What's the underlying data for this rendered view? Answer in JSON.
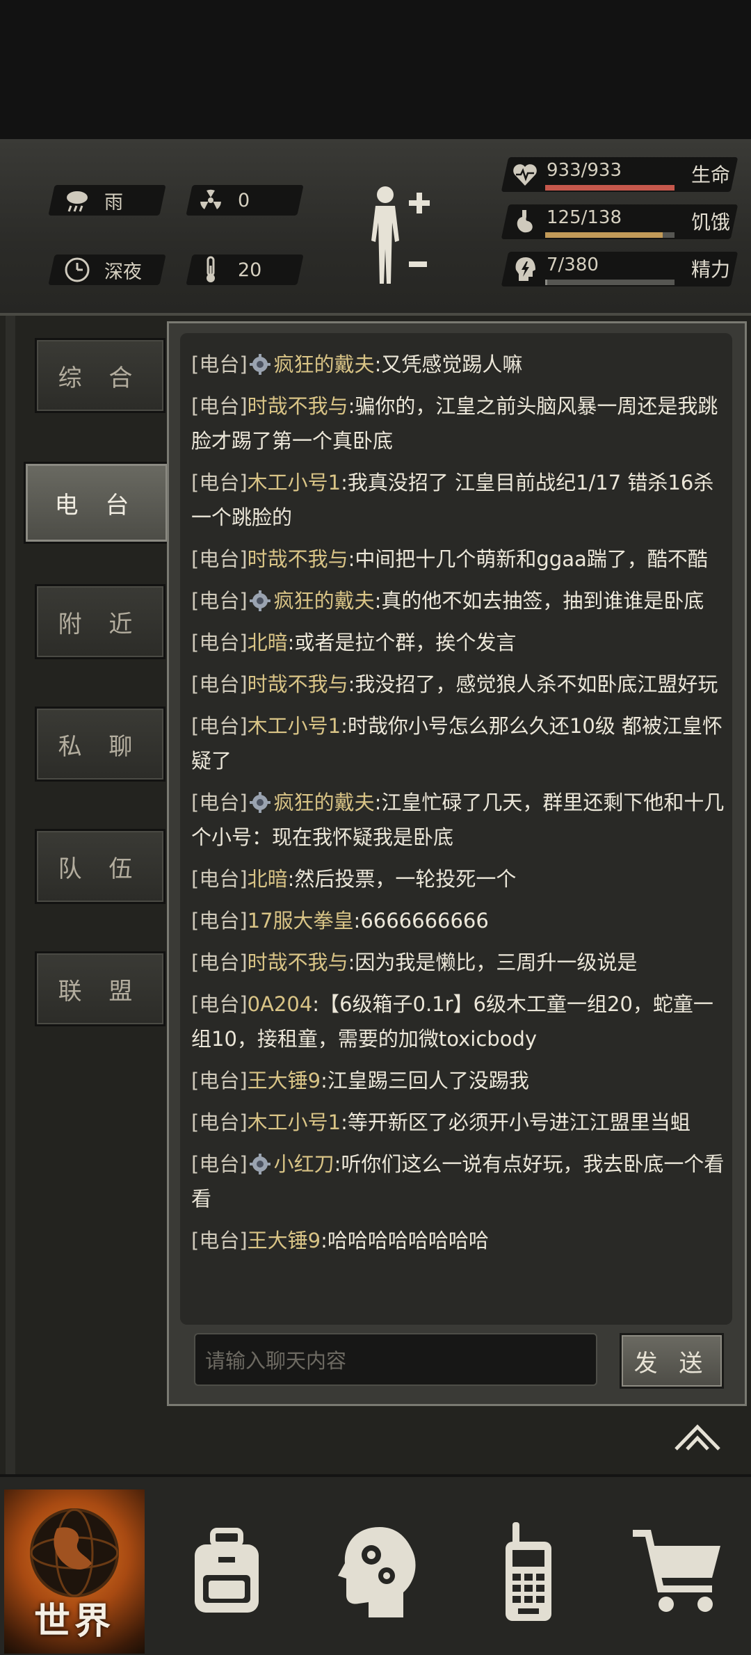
{
  "status": {
    "weather": "雨",
    "radiation": "0",
    "time_of_day": "深夜",
    "temperature": "20",
    "health": {
      "text": "933/933",
      "label": "生命",
      "fraction": 1.0,
      "color": "#c6584c"
    },
    "hunger": {
      "text": "125/138",
      "label": "饥饿",
      "fraction": 0.906,
      "color": "#c29a58"
    },
    "energy": {
      "text": "7/380",
      "label": "精力",
      "fraction": 0.018,
      "color": "#8a8a84"
    }
  },
  "tabs": [
    "综 合",
    "电 台",
    "附 近",
    "私 聊",
    "队 伍",
    "联 盟"
  ],
  "active_tab": "电 台",
  "messages": [
    {
      "channel": "[电台]",
      "icon": true,
      "name": "疯狂的戴夫",
      "text": ":又凭感觉踢人嘛"
    },
    {
      "channel": "[电台]",
      "icon": false,
      "name": "时哉不我与",
      "text": ":骗你的，江皇之前头脑风暴一周还是我跳脸才踢了第一个真卧底"
    },
    {
      "channel": "[电台]",
      "icon": false,
      "name": "木工小号1",
      "text": ":我真没招了 江皇目前战纪1/17 错杀16杀一个跳脸的"
    },
    {
      "channel": "[电台]",
      "icon": false,
      "name": "时哉不我与",
      "text": ":中间把十几个萌新和ggaa踹了，酷不酷"
    },
    {
      "channel": "[电台]",
      "icon": true,
      "name": "疯狂的戴夫",
      "text": ":真的他不如去抽签，抽到谁谁是卧底"
    },
    {
      "channel": "[电台]",
      "icon": false,
      "name": "北暗",
      "text": ":或者是拉个群，挨个发言"
    },
    {
      "channel": "[电台]",
      "icon": false,
      "name": "时哉不我与",
      "text": ":我没招了，感觉狼人杀不如卧底江盟好玩"
    },
    {
      "channel": "[电台]",
      "icon": false,
      "name": "木工小号1",
      "text": ":时哉你小号怎么那么久还10级 都被江皇怀疑了"
    },
    {
      "channel": "[电台]",
      "icon": true,
      "name": "疯狂的戴夫",
      "text": ":江皇忙碌了几天，群里还剩下他和十几个小号：现在我怀疑我是卧底"
    },
    {
      "channel": "[电台]",
      "icon": false,
      "name": "北暗",
      "text": ":然后投票，一轮投死一个"
    },
    {
      "channel": "[电台]",
      "icon": false,
      "name": "17服大拳皇",
      "text": ":6666666666"
    },
    {
      "channel": "[电台]",
      "icon": false,
      "name": "时哉不我与",
      "text": ":因为我是懒比，三周升一级说是"
    },
    {
      "channel": "[电台]",
      "icon": false,
      "name": "0A204",
      "text": ":【6级箱子0.1r】6级木工童一组20，蛇童一组10，接租童，需要的加微toxicbody"
    },
    {
      "channel": "[电台]",
      "icon": false,
      "name": "王大锤9",
      "text": ":江皇踢三回人了没踢我"
    },
    {
      "channel": "[电台]",
      "icon": false,
      "name": "木工小号1",
      "text": ":等开新区了必须开小号进江江盟里当蛆"
    },
    {
      "channel": "[电台]",
      "icon": true,
      "name": "小红刀",
      "text": ":听你们这么一说有点好玩，我去卧底一个看看"
    },
    {
      "channel": "[电台]",
      "icon": false,
      "name": "王大锤9",
      "text": ":哈哈哈哈哈哈哈哈"
    }
  ],
  "input": {
    "placeholder": "请输入聊天内容"
  },
  "send_label": "发 送",
  "nav": {
    "world_label": "世界",
    "active": "world"
  }
}
